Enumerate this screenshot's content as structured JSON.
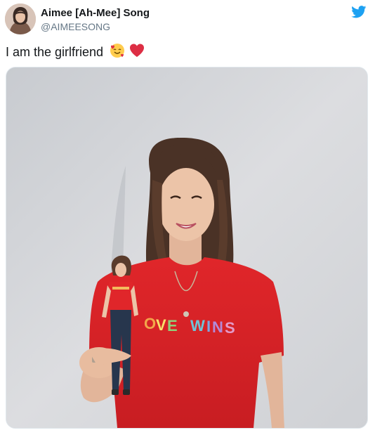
{
  "tweet": {
    "display_name": "Aimee [Ah-Mee] Song",
    "handle": "@AIMEESONG",
    "text": "I am the girlfriend",
    "emojis": [
      "smiling-face-with-hearts",
      "red-heart"
    ],
    "brand_icon": "twitter-bird-icon",
    "brand_color": "#1da1f2"
  },
  "photo": {
    "shirt_text": "LOVE WINS",
    "description_icon": "photo"
  }
}
